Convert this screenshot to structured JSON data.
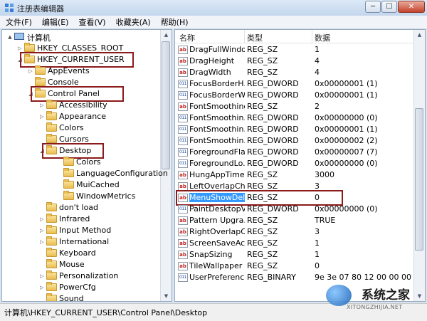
{
  "window": {
    "title": "注册表编辑器",
    "min_glyph": "─",
    "max_glyph": "☐",
    "close_glyph": "✕"
  },
  "menu": [
    "文件(F)",
    "编辑(E)",
    "查看(V)",
    "收藏夹(A)",
    "帮助(H)"
  ],
  "tree": {
    "items": [
      {
        "label": "计算机",
        "level": 0,
        "expander": "▲",
        "icon": "computer-icon"
      },
      {
        "label": "HKEY_CLASSES_ROOT",
        "level": 1,
        "expander": "▷",
        "icon": "folder-icon"
      },
      {
        "label": "HKEY_CURRENT_USER",
        "level": 1,
        "expander": "◢",
        "icon": "folder-icon",
        "highlighted": true
      },
      {
        "label": "AppEvents",
        "level": 2,
        "expander": "▷",
        "icon": "folder-icon"
      },
      {
        "label": "Console",
        "level": 2,
        "expander": "",
        "icon": "folder-icon"
      },
      {
        "label": "Control Panel",
        "level": 2,
        "expander": "◢",
        "icon": "folder-icon",
        "highlighted": true
      },
      {
        "label": "Accessibility",
        "level": 3,
        "expander": "▷",
        "icon": "folder-icon"
      },
      {
        "label": "Appearance",
        "level": 3,
        "expander": "▷",
        "icon": "folder-icon"
      },
      {
        "label": "Colors",
        "level": 3,
        "expander": "",
        "icon": "folder-icon"
      },
      {
        "label": "Cursors",
        "level": 3,
        "expander": "",
        "icon": "folder-icon"
      },
      {
        "label": "Desktop",
        "level": 3,
        "expander": "◢",
        "icon": "folder-icon",
        "highlighted": true
      },
      {
        "label": "Colors",
        "level": 4,
        "expander": "",
        "icon": "folder-icon"
      },
      {
        "label": "LanguageConfiguration",
        "level": 4,
        "expander": "",
        "icon": "folder-icon"
      },
      {
        "label": "MuiCached",
        "level": 4,
        "expander": "",
        "icon": "folder-icon"
      },
      {
        "label": "WindowMetrics",
        "level": 4,
        "expander": "",
        "icon": "folder-icon"
      },
      {
        "label": "don't load",
        "level": 3,
        "expander": "",
        "icon": "folder-icon"
      },
      {
        "label": "Infrared",
        "level": 3,
        "expander": "▷",
        "icon": "folder-icon"
      },
      {
        "label": "Input Method",
        "level": 3,
        "expander": "▷",
        "icon": "folder-icon"
      },
      {
        "label": "International",
        "level": 3,
        "expander": "▷",
        "icon": "folder-icon"
      },
      {
        "label": "Keyboard",
        "level": 3,
        "expander": "",
        "icon": "folder-icon"
      },
      {
        "label": "Mouse",
        "level": 3,
        "expander": "",
        "icon": "folder-icon"
      },
      {
        "label": "Personalization",
        "level": 3,
        "expander": "▷",
        "icon": "folder-icon"
      },
      {
        "label": "PowerCfg",
        "level": 3,
        "expander": "▷",
        "icon": "folder-icon"
      },
      {
        "label": "Sound",
        "level": 3,
        "expander": "",
        "icon": "folder-icon"
      }
    ]
  },
  "list": {
    "columns": {
      "name": "名称",
      "type": "类型",
      "data": "数据"
    },
    "rows": [
      {
        "name": "DragFullWindo...",
        "type": "REG_SZ",
        "data": "1",
        "icon": "ab"
      },
      {
        "name": "DragHeight",
        "type": "REG_SZ",
        "data": "4",
        "icon": "ab"
      },
      {
        "name": "DragWidth",
        "type": "REG_SZ",
        "data": "4",
        "icon": "ab"
      },
      {
        "name": "FocusBorderH...",
        "type": "REG_DWORD",
        "data": "0x00000001 (1)",
        "icon": "bin"
      },
      {
        "name": "FocusBorderW...",
        "type": "REG_DWORD",
        "data": "0x00000001 (1)",
        "icon": "bin"
      },
      {
        "name": "FontSmoothing",
        "type": "REG_SZ",
        "data": "2",
        "icon": "ab"
      },
      {
        "name": "FontSmoothin...",
        "type": "REG_DWORD",
        "data": "0x00000000 (0)",
        "icon": "bin"
      },
      {
        "name": "FontSmoothin...",
        "type": "REG_DWORD",
        "data": "0x00000001 (1)",
        "icon": "bin"
      },
      {
        "name": "FontSmoothin...",
        "type": "REG_DWORD",
        "data": "0x00000002 (2)",
        "icon": "bin"
      },
      {
        "name": "ForegroundFla...",
        "type": "REG_DWORD",
        "data": "0x00000007 (7)",
        "icon": "bin"
      },
      {
        "name": "ForegroundLo...",
        "type": "REG_DWORD",
        "data": "0x00000000 (0)",
        "icon": "bin"
      },
      {
        "name": "HungAppTime...",
        "type": "REG_SZ",
        "data": "3000",
        "icon": "ab"
      },
      {
        "name": "LeftOverlapCh...",
        "type": "REG_SZ",
        "data": "3",
        "icon": "ab"
      },
      {
        "name": "MenuShowDelay",
        "type": "REG_SZ",
        "data": "0",
        "icon": "ab",
        "selected": true
      },
      {
        "name": "PaintDesktopV...",
        "type": "REG_DWORD",
        "data": "0x00000000 (0)",
        "icon": "bin"
      },
      {
        "name": "Pattern Upgra...",
        "type": "REG_SZ",
        "data": "TRUE",
        "icon": "ab"
      },
      {
        "name": "RightOverlapC...",
        "type": "REG_SZ",
        "data": "3",
        "icon": "ab"
      },
      {
        "name": "ScreenSaveActi...",
        "type": "REG_SZ",
        "data": "1",
        "icon": "ab"
      },
      {
        "name": "SnapSizing",
        "type": "REG_SZ",
        "data": "1",
        "icon": "ab"
      },
      {
        "name": "TileWallpaper",
        "type": "REG_SZ",
        "data": "0",
        "icon": "ab"
      },
      {
        "name": "UserPreferenc...",
        "type": "REG_BINARY",
        "data": "9e 3e 07 80 12 00 00 00",
        "icon": "bin"
      }
    ]
  },
  "icons": {
    "ab": "ab",
    "bin": "011"
  },
  "status": {
    "path": "计算机\\HKEY_CURRENT_USER\\Control Panel\\Desktop"
  },
  "watermark": {
    "text": "系统之家",
    "sub": "XITONGZHIJIA.NET"
  },
  "colors": {
    "highlight_box": "#8b1a1a",
    "selection": "#3399ff"
  }
}
